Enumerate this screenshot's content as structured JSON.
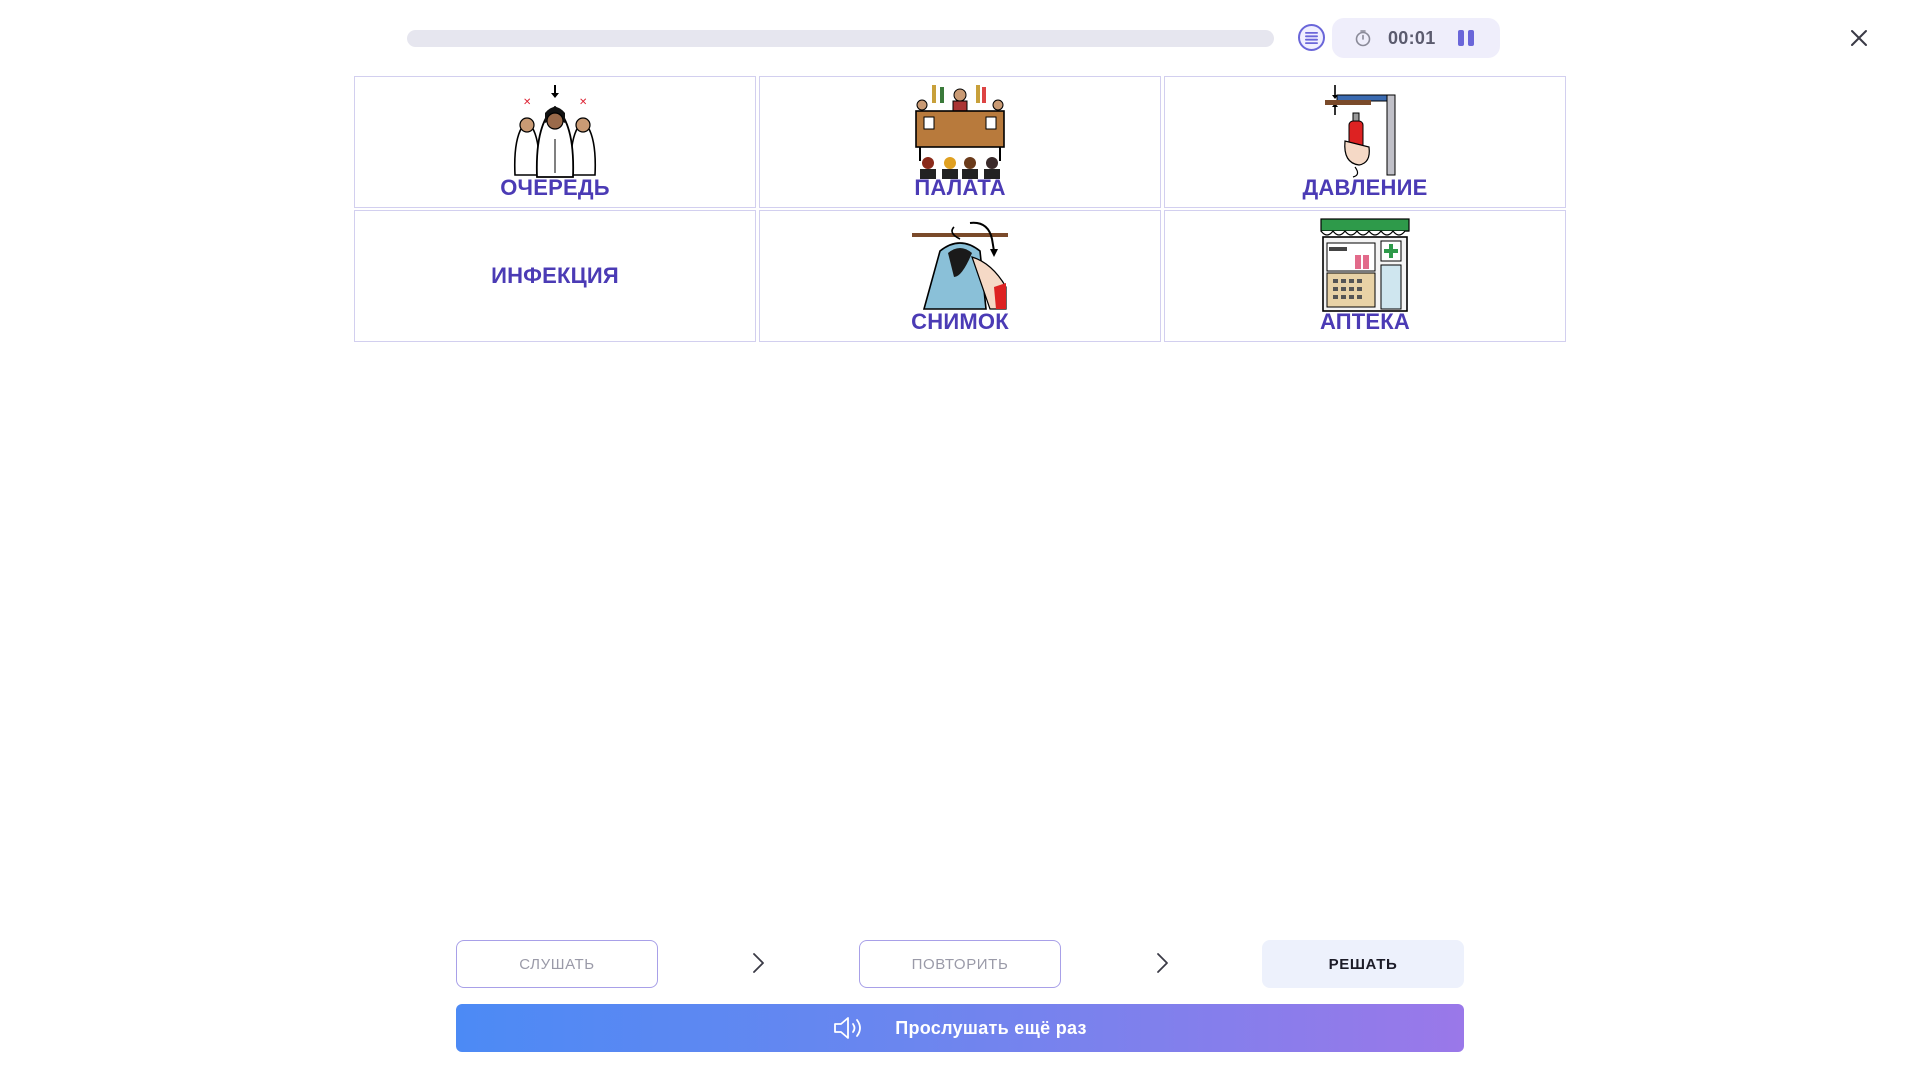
{
  "header": {
    "progress_fraction": 0,
    "timer": "00:01",
    "icons": {
      "list": "list-icon",
      "clock": "clock-icon",
      "pause": "pause-icon",
      "close": "close-icon"
    }
  },
  "cards": [
    {
      "label": "ОЧЕРЕДЬ",
      "picture": "queue-people-pictogram"
    },
    {
      "label": "ПАЛАТА",
      "picture": "chamber-hall-pictogram"
    },
    {
      "label": "ДАВЛЕНИЕ",
      "picture": "pressure-clamp-pictogram"
    },
    {
      "label": "ИНФЕКЦИЯ",
      "picture": ""
    },
    {
      "label": "СНИМОК",
      "picture": "taking-off-clothes-pictogram"
    },
    {
      "label": "АПТЕКА",
      "picture": "pharmacy-shop-pictogram"
    }
  ],
  "steps": {
    "listen": "СЛУШАТЬ",
    "repeat": "ПОВТОРИТЬ",
    "solve": "РЕШАТЬ"
  },
  "replay": {
    "label": "Прослушать ещё раз",
    "icon": "speaker-icon"
  },
  "colors": {
    "accent": "#6a66d9",
    "card_label": "#4b3bb5",
    "gradient_start": "#4c8af5",
    "gradient_end": "#9a78e9"
  }
}
